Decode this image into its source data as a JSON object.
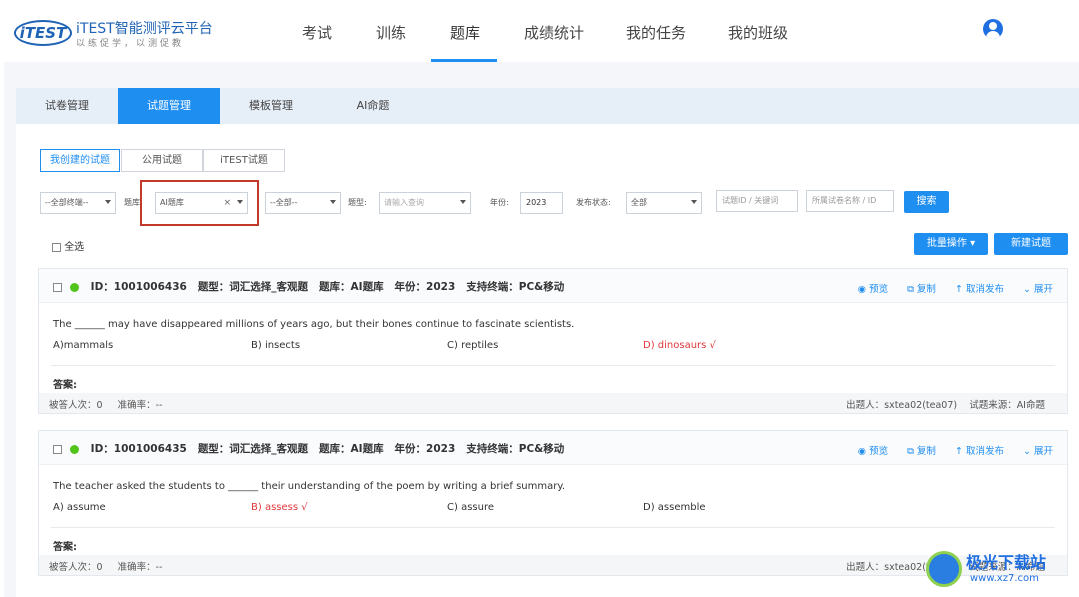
{
  "logo": {
    "mark": "iTEST",
    "name": "iTEST智能测评云平台",
    "slogan": "以练促学，以测促教"
  },
  "nav": [
    "考试",
    "训练",
    "题库",
    "成绩统计",
    "我的任务",
    "我的班级"
  ],
  "nav_active": "题库",
  "tabs": [
    "试卷管理",
    "试题管理",
    "模板管理",
    "AI命题"
  ],
  "tab_active": "试题管理",
  "subtabs": [
    "我创建的试题",
    "公用试题",
    "iTEST试题"
  ],
  "filters": {
    "terminal": "--全部终端--",
    "bank_label": "题库",
    "bank_value": "AI题库",
    "bank_clear": "×",
    "category": "--全部--",
    "type_label": "题型:",
    "type_placeholder": "请输入查询",
    "year_label": "年份:",
    "year_value": "2023",
    "status_label": "发布状态:",
    "status_value": "全部",
    "id_placeholder": "试题ID / 关键词",
    "paper_placeholder": "所属试卷名称 / ID",
    "search_button": "搜索"
  },
  "select_all": "全选",
  "batch_button": "批量操作 ▾",
  "new_button": "新建试题",
  "actions": [
    "预览",
    "复制",
    "取消发布",
    "展开"
  ],
  "questions": [
    {
      "id": "ID：1001006436",
      "type": "题型：词汇选择_客观题",
      "bank": "题库：AI题库",
      "year": "年份：2023",
      "terminal": "支持终端：PC&移动",
      "stem": "The ______ may have disappeared millions of years ago, but their bones continue to fascinate scientists.",
      "options": [
        "A)mammals",
        "B)  insects",
        "C)  reptiles",
        "D)  dinosaurs √"
      ],
      "correct_index": 3,
      "answer_label": "答案:",
      "answered": "被答人次：0",
      "accuracy": "准确率：--",
      "author": "出题人：sxtea02(tea07)",
      "source": "试题来源：AI命题"
    },
    {
      "id": "ID：1001006435",
      "type": "题型：词汇选择_客观题",
      "bank": "题库：AI题库",
      "year": "年份：2023",
      "terminal": "支持终端：PC&移动",
      "stem": "The teacher asked the students to ______ their understanding of the poem by writing a brief summary.",
      "options": [
        "A) assume",
        "B) assess √",
        "C) assure",
        "D) assemble"
      ],
      "correct_index": 1,
      "answer_label": "答案:",
      "answered": "被答人次：0",
      "accuracy": "准确率：--",
      "author": "出题人：sxtea02(tea07)",
      "source": "试题来源：AI命题"
    }
  ],
  "watermark": {
    "title": "极光下载站",
    "url": "www.xz7.com"
  },
  "colors": {
    "accent": "#1f8ef1",
    "brand": "#1f63b5",
    "correct": "#e0363a",
    "ok": "#52c41a",
    "highlight": "#c0392b"
  },
  "icons": [
    "user-avatar-icon",
    "eye-icon",
    "copy-icon",
    "arrow-up-icon",
    "chevron-down-icon",
    "check-circle-icon"
  ]
}
